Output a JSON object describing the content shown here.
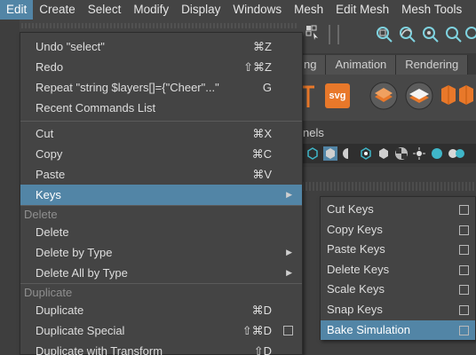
{
  "menubar": {
    "items": [
      "Edit",
      "Create",
      "Select",
      "Modify",
      "Display",
      "Windows",
      "Mesh",
      "Edit Mesh",
      "Mesh Tools"
    ],
    "active_index": 0
  },
  "shelf": {
    "tabs": [
      "ng",
      "Animation",
      "Rendering"
    ],
    "svg_icon_label": "svg"
  },
  "panels": {
    "label": "nels"
  },
  "edit_menu": {
    "items": [
      {
        "label": "Undo \"select\"",
        "shortcut": "⌘Z"
      },
      {
        "label": "Redo",
        "shortcut": "⇧⌘Z"
      },
      {
        "label": "Repeat \"string $layers[]={\"Cheer\"...\"",
        "shortcut": "G"
      },
      {
        "label": "Recent Commands List",
        "shortcut": ""
      },
      {
        "label": "Cut",
        "shortcut": "⌘X"
      },
      {
        "label": "Copy",
        "shortcut": "⌘C"
      },
      {
        "label": "Paste",
        "shortcut": "⌘V"
      },
      {
        "label": "Keys",
        "shortcut": ""
      },
      {
        "label": "Delete",
        "shortcut": ""
      },
      {
        "label": "Delete by Type",
        "shortcut": ""
      },
      {
        "label": "Delete All by Type",
        "shortcut": ""
      },
      {
        "label": "Duplicate",
        "shortcut": "⌘D"
      },
      {
        "label": "Duplicate Special",
        "shortcut": "⇧⌘D"
      },
      {
        "label": "Duplicate with Transform",
        "shortcut": "⇧D"
      }
    ],
    "sections": [
      "Delete",
      "Duplicate"
    ]
  },
  "keys_menu": {
    "items": [
      "Cut Keys",
      "Copy Keys",
      "Paste Keys",
      "Delete Keys",
      "Scale Keys",
      "Snap Keys",
      "Bake Simulation"
    ]
  },
  "colors": {
    "highlight": "#5285a6",
    "menu_bg": "#444444",
    "section_text": "#8f8f8f",
    "accent_orange": "#e8782a",
    "accent_teal": "#3fb6c8"
  },
  "icons": [
    "move-icon",
    "snap-curve-icon",
    "snap-point-icon",
    "text-icon",
    "svg-icon",
    "polygon-icon",
    "camera-icon",
    "wireframe-icon",
    "shaded-icon",
    "light-icon",
    "submenu-arrow-icon",
    "option-box-icon"
  ]
}
